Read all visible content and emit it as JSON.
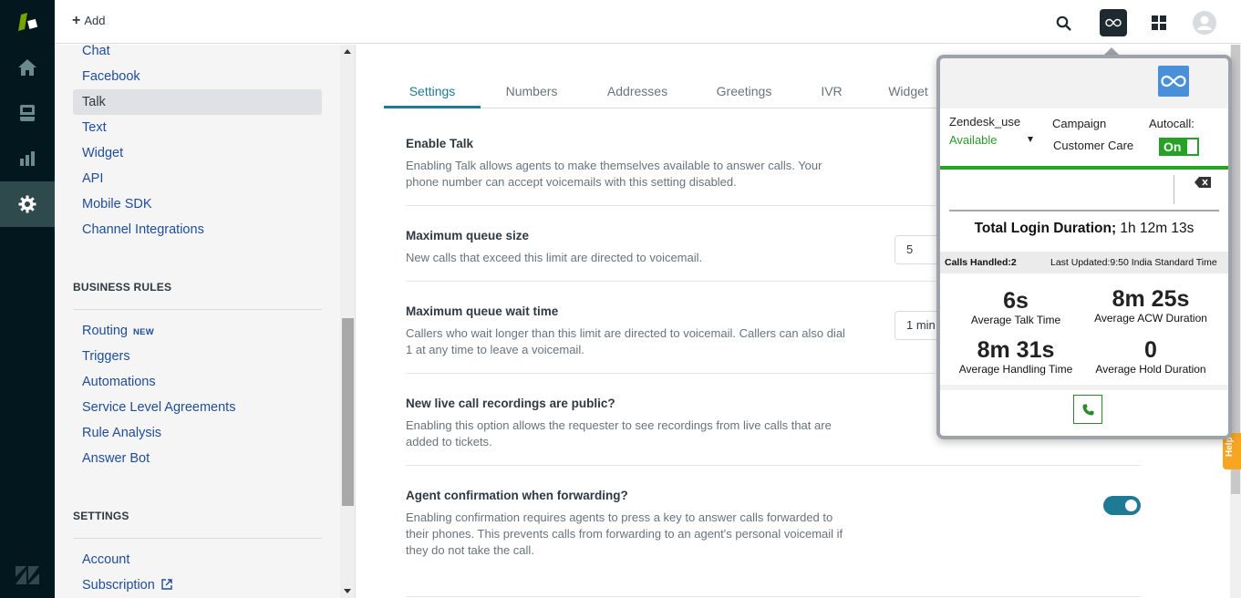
{
  "header": {
    "add_label": "Add"
  },
  "rail": {
    "items": [
      "home",
      "views",
      "reporting",
      "admin"
    ]
  },
  "sidebar": {
    "channel_items": [
      {
        "label": "Chat"
      },
      {
        "label": "Facebook"
      },
      {
        "label": "Talk",
        "active": true
      },
      {
        "label": "Text"
      },
      {
        "label": "Widget"
      },
      {
        "label": "API"
      },
      {
        "label": "Mobile SDK"
      },
      {
        "label": "Channel Integrations"
      }
    ],
    "business_rules_heading": "BUSINESS RULES",
    "business_rules_items": [
      {
        "label": "Routing",
        "badge": "NEW"
      },
      {
        "label": "Triggers"
      },
      {
        "label": "Automations"
      },
      {
        "label": "Service Level Agreements"
      },
      {
        "label": "Rule Analysis"
      },
      {
        "label": "Answer Bot"
      }
    ],
    "settings_heading": "SETTINGS",
    "settings_items": [
      {
        "label": "Account"
      },
      {
        "label": "Subscription"
      }
    ]
  },
  "main": {
    "tabs": [
      {
        "label": "Settings",
        "active": true
      },
      {
        "label": "Numbers"
      },
      {
        "label": "Addresses"
      },
      {
        "label": "Greetings"
      },
      {
        "label": "IVR"
      },
      {
        "label": "Widget"
      }
    ],
    "settings": [
      {
        "title": "Enable Talk",
        "desc": "Enabling Talk allows agents to make themselves available to answer calls. Your phone number can accept voicemails with this setting disabled."
      },
      {
        "title": "Maximum queue size",
        "desc": "New calls that exceed this limit are directed to voicemail.",
        "value": "5"
      },
      {
        "title": "Maximum queue wait time",
        "desc": "Callers who wait longer than this limit are directed to voicemail. Callers can also dial 1 at any time to leave a voicemail.",
        "value": "1 min"
      },
      {
        "title": "New live call recordings are public?",
        "desc": "Enabling this option allows the requester to see recordings from live calls that are added to tickets."
      },
      {
        "title": "Agent confirmation when forwarding?",
        "desc": "Enabling confirmation requires agents to press a key to answer calls forwarded to their phones. This prevents calls from forwarding to an agent's personal voicemail if they do not take the call.",
        "enabled": true
      }
    ]
  },
  "help_tab": "Help",
  "dialer": {
    "username": "Zendesk_use",
    "status": "Available",
    "campaign_label": "Campaign",
    "campaign_value": "Customer Care",
    "autocall_label": "Autocall:",
    "autocall_state": "On",
    "dial_input_value": "",
    "total_login_label": "Total Login Duration;",
    "total_login_value": "1h 12m 13s",
    "calls_handled": "Calls Handled:2",
    "last_updated": "Last Updated:9:50 India Standard Time",
    "metrics": [
      {
        "value": "6s",
        "label": "Average Talk Time"
      },
      {
        "value": "8m 25s",
        "label": "Average ACW Duration"
      },
      {
        "value": "8m 31s",
        "label": "Average Handling Time"
      },
      {
        "value": "0",
        "label": "Average Hold Duration"
      }
    ],
    "colors": {
      "status_green": "#26a326",
      "logo_blue": "#4a90d9"
    }
  },
  "colors": {
    "rail_bg": "#03181e",
    "accent_teal": "#1f7a96",
    "link_blue": "#1f4c9b",
    "help_orange": "#f6a623"
  }
}
